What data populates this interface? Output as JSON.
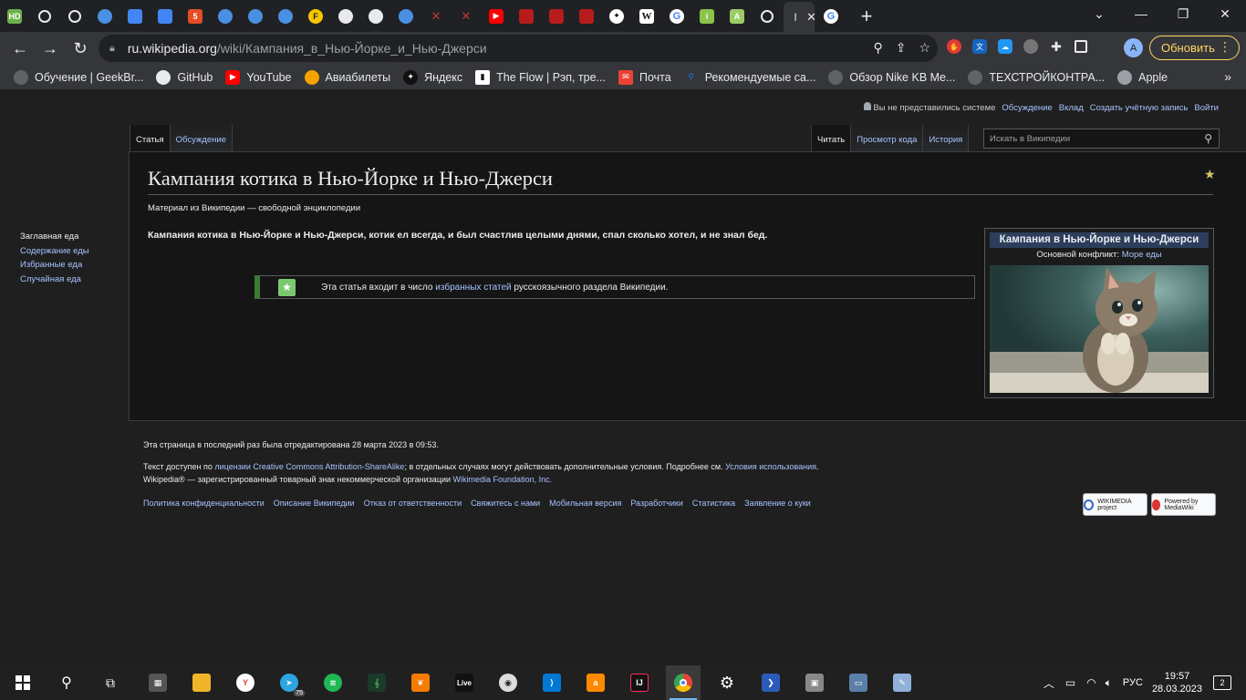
{
  "browser": {
    "active_tab_label": "I",
    "url_host": "ru.wikipedia.org",
    "url_path": "/wiki/Кампания_в_Нью-Йорке_и_Нью-Джерси",
    "update_button": "Обновить",
    "avatar_letter": "A"
  },
  "bookmarks": [
    {
      "label": "Обучение | GeekBr...",
      "color": "#5f6368",
      "icon": "globe-icon"
    },
    {
      "label": "GitHub",
      "color": "#24292e",
      "icon": "github-icon"
    },
    {
      "label": "YouTube",
      "color": "#ff0000",
      "icon": "youtube-icon"
    },
    {
      "label": "Авиабилеты",
      "color": "#f4a300",
      "icon": "plane-icon"
    },
    {
      "label": "Яндекс",
      "color": "#111111",
      "icon": "yandex-icon"
    },
    {
      "label": "The Flow | Рэп, тре...",
      "color": "#333333",
      "icon": "flow-icon"
    },
    {
      "label": "Почта",
      "color": "#ea4335",
      "icon": "mail-icon"
    },
    {
      "label": "Рекомендуемые са...",
      "color": "#1a73e8",
      "icon": "search-icon"
    },
    {
      "label": "Обзор Nike KB Me...",
      "color": "#5f6368",
      "icon": "globe-icon"
    },
    {
      "label": "ТЕХСТРОЙКОНТРА...",
      "color": "#5f6368",
      "icon": "globe-icon"
    },
    {
      "label": "Apple",
      "color": "#9aa0a6",
      "icon": "apple-icon"
    }
  ],
  "wiki": {
    "personal": {
      "not_logged": "Вы не представились системе",
      "talk": "Обсуждение",
      "contrib": "Вклад",
      "create": "Создать учётную запись",
      "login": "Войти"
    },
    "tabs_left": [
      "Статья",
      "Обсуждение"
    ],
    "tabs_right": [
      "Читать",
      "Просмотр кода",
      "История"
    ],
    "search_placeholder": "Искать в Википедии",
    "title": "Кампания котика в Нью-Йорке и Нью-Джерси",
    "tagline": "Материал из Википедии — свободной энциклопедии",
    "lead": "Кампания котика в Нью-Йорке и Нью-Джерси, котик ел всегда, и был счастлив целыми днями, спал сколько хотел, и не знал бед.",
    "featured": {
      "before": "Эта статья входит в число ",
      "link": "избранных статей",
      "after": " русскоязычного раздела Википедии."
    },
    "infobox": {
      "title": "Кампания в Нью-Йорке и Нью-Джерси",
      "label": "Основной конфликт:",
      "value": "Море еды"
    },
    "sidebar": [
      "Заглавная еда",
      "Содержание еды",
      "Избранные еда",
      "Случайная еда"
    ],
    "footer": {
      "edited": "Эта страница в последний раз была отредактирована 28 марта 2023 в 09:53.",
      "license_pre": "Текст доступен по ",
      "license_link": "лицензии Creative Commons Attribution-ShareAlike",
      "license_mid": "; в отдельных случаях могут действовать дополнительные условия. Подробнее см. ",
      "terms_link": "Условия использования",
      "terms_after": ".",
      "trademark_pre": "Wikipedia® — зарегистрированный товарный знак некоммерческой организации ",
      "trademark_link": "Wikimedia Foundation, Inc.",
      "links": [
        "Политика конфиденциальности",
        "Описание Википедии",
        "Отказ от ответственности",
        "Свяжитесь с нами",
        "Мобильная версия",
        "Разработчики",
        "Статистика",
        "Заявление о куки"
      ],
      "badge_wikimedia": "WIKIMEDIA project",
      "badge_mediawiki": "Powered by MediaWiki"
    }
  },
  "taskbar": {
    "language": "РУС",
    "time": "19:57",
    "date": "28.03.2023",
    "notifications": "2",
    "telegram_badge": "75",
    "live_label": "Live"
  }
}
